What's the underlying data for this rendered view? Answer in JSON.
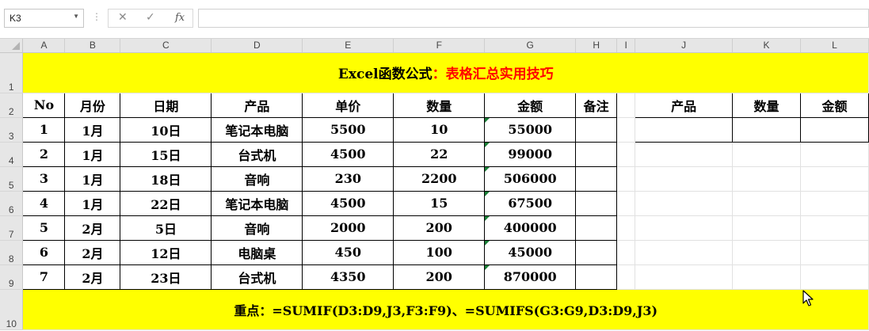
{
  "formula_bar": {
    "name_box": "K3",
    "dots": "⋮",
    "cancel_glyph": "✕",
    "enter_glyph": "✓",
    "fx_label": "fx",
    "formula": ""
  },
  "columns": [
    "A",
    "B",
    "C",
    "D",
    "E",
    "F",
    "G",
    "H",
    "I",
    "J",
    "K",
    "L"
  ],
  "rows": [
    "1",
    "2",
    "3",
    "4",
    "5",
    "6",
    "7",
    "8",
    "9",
    "10"
  ],
  "title": {
    "part1": "Excel函数公式",
    "part2": "：表格汇总实用技巧"
  },
  "table": {
    "headers": [
      "No",
      "月份",
      "日期",
      "产品",
      "单价",
      "数量",
      "金额",
      "备注"
    ],
    "rows": [
      [
        "1",
        "1月",
        "10日",
        "笔记本电脑",
        "5500",
        "10",
        "55000",
        ""
      ],
      [
        "2",
        "1月",
        "15日",
        "台式机",
        "4500",
        "22",
        "99000",
        ""
      ],
      [
        "3",
        "1月",
        "18日",
        "音响",
        "230",
        "2200",
        "506000",
        ""
      ],
      [
        "4",
        "1月",
        "22日",
        "笔记本电脑",
        "4500",
        "15",
        "67500",
        ""
      ],
      [
        "5",
        "2月",
        "5日",
        "音响",
        "2000",
        "200",
        "400000",
        ""
      ],
      [
        "6",
        "2月",
        "12日",
        "电脑桌",
        "450",
        "100",
        "45000",
        ""
      ],
      [
        "7",
        "2月",
        "23日",
        "台式机",
        "4350",
        "200",
        "870000",
        ""
      ]
    ]
  },
  "summary": {
    "headers": [
      "产品",
      "数量",
      "金额"
    ],
    "row": [
      "",
      "",
      ""
    ]
  },
  "note": {
    "label": "重点：",
    "formula": "=SUMIF(D3:D9,J3,F3:F9)、=SUMIFS(G3:G9,D3:D9,J3)"
  },
  "colors": {
    "highlight": "#ffff00",
    "accent_red": "#ff0000",
    "header_gray": "#e6e6e6"
  }
}
